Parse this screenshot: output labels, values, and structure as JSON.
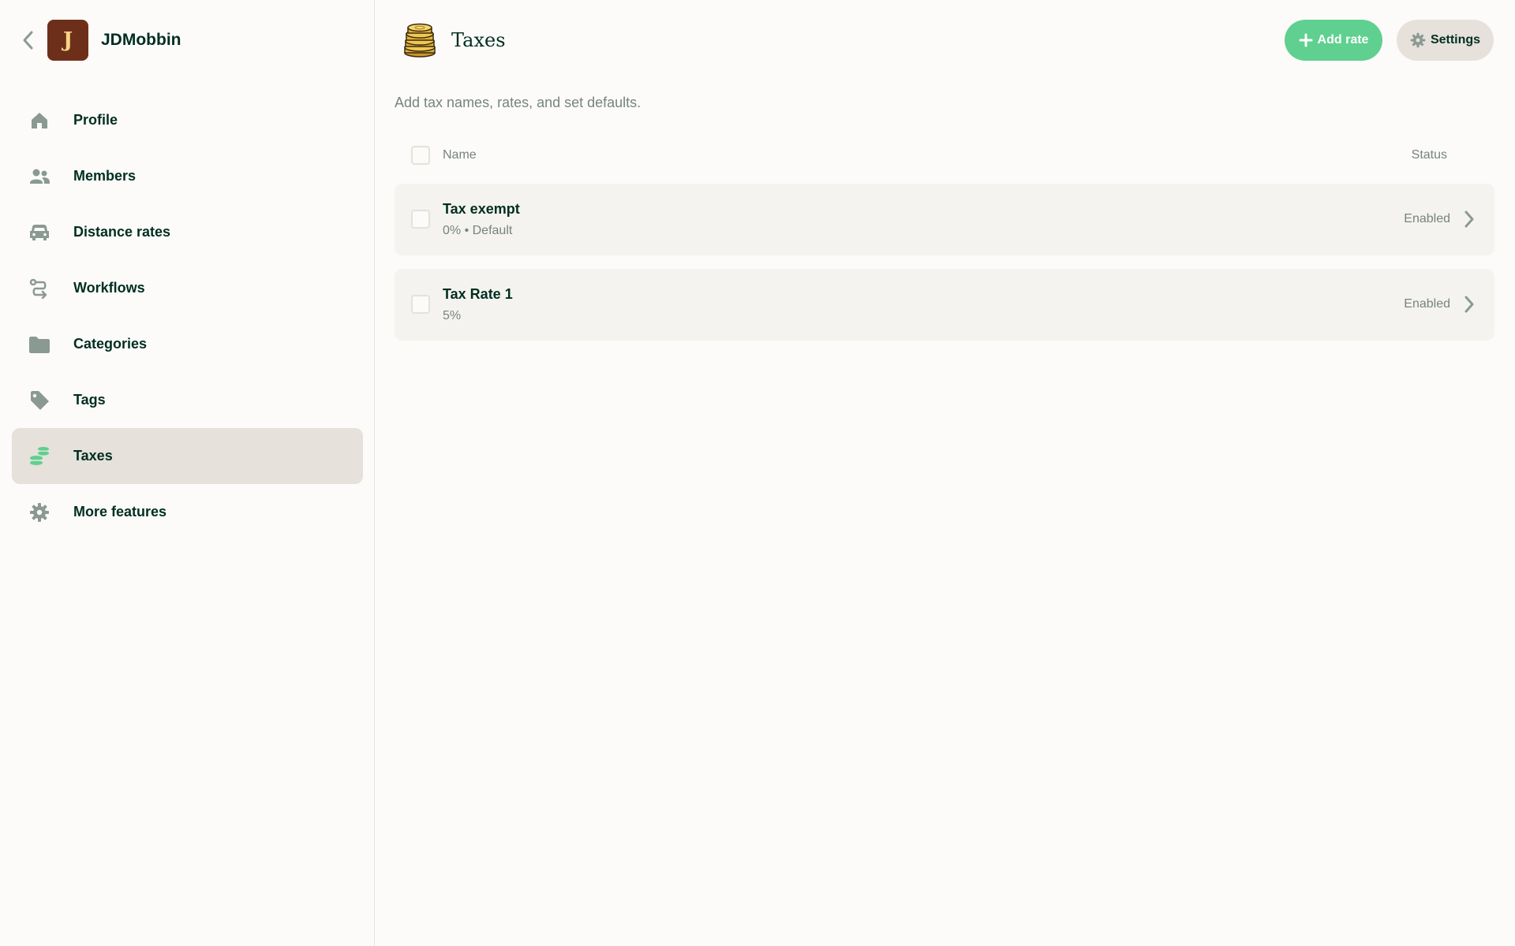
{
  "sidebar": {
    "workspace": {
      "initial": "J",
      "name": "JDMobbin"
    },
    "items": [
      {
        "label": "Profile",
        "icon": "home-icon"
      },
      {
        "label": "Members",
        "icon": "users-icon"
      },
      {
        "label": "Distance rates",
        "icon": "car-icon"
      },
      {
        "label": "Workflows",
        "icon": "workflow-icon"
      },
      {
        "label": "Categories",
        "icon": "folder-icon"
      },
      {
        "label": "Tags",
        "icon": "tag-icon"
      },
      {
        "label": "Taxes",
        "icon": "coins-icon",
        "active": true
      },
      {
        "label": "More features",
        "icon": "gear-icon"
      }
    ]
  },
  "header": {
    "title": "Taxes",
    "add_label": "Add rate",
    "settings_label": "Settings"
  },
  "subtitle": "Add tax names, rates, and set defaults.",
  "table": {
    "columns": {
      "name": "Name",
      "status": "Status"
    },
    "rows": [
      {
        "title": "Tax exempt",
        "sub": "0% • Default",
        "status": "Enabled"
      },
      {
        "title": "Tax Rate 1",
        "sub": "5%",
        "status": "Enabled"
      }
    ]
  },
  "colors": {
    "accent": "#5fd08f",
    "active_bg": "#e6e1da",
    "text": "#002e22",
    "muted": "#76847e",
    "avatar_bg": "#6e2f1a"
  }
}
